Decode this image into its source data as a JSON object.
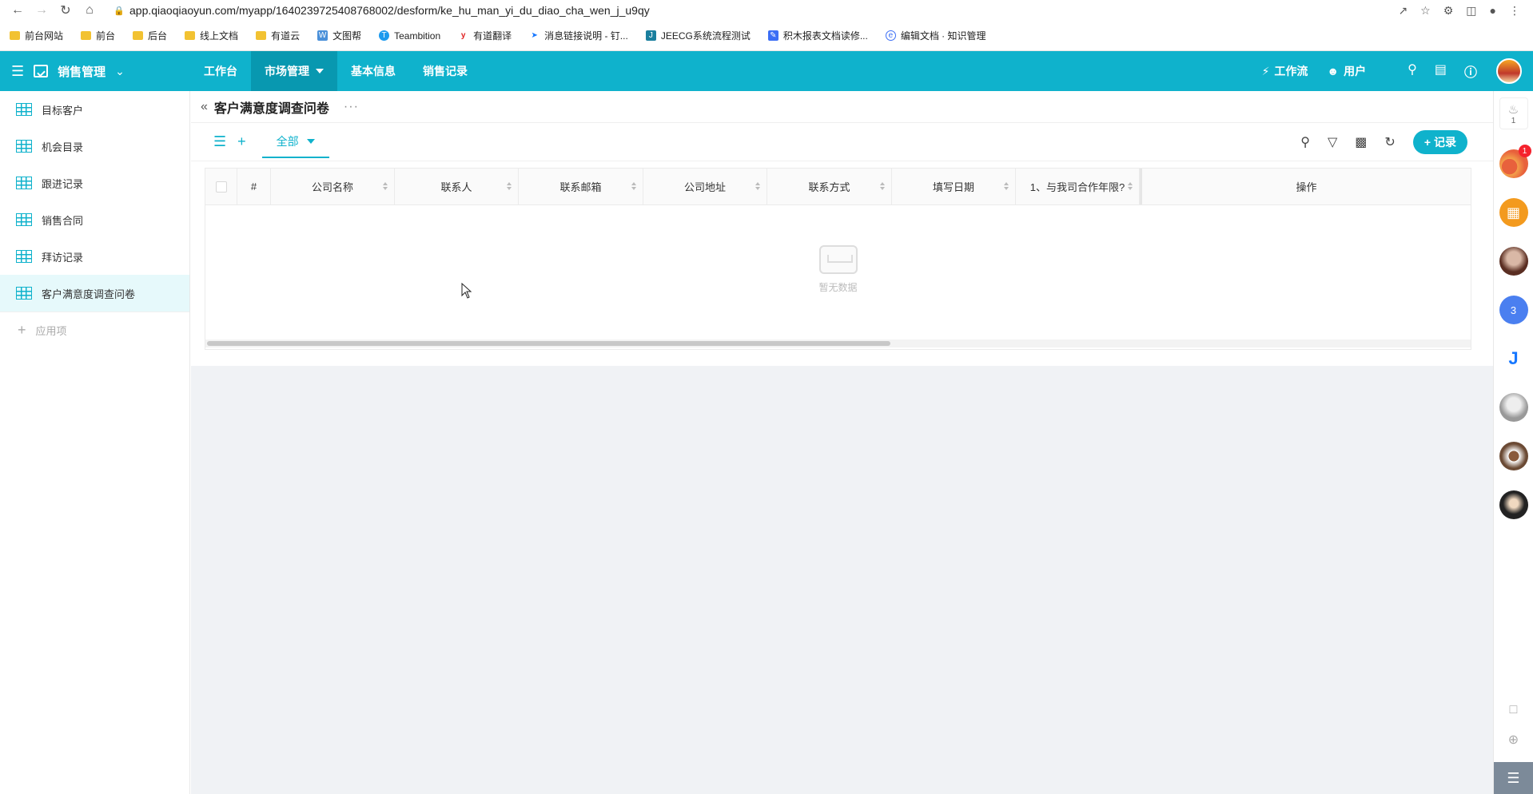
{
  "browser": {
    "url": "app.qiaoqiaoyun.com/myapp/1640239725408768002/desform/ke_hu_man_yi_du_diao_cha_wen_j_u9qy",
    "bookmarks": [
      "前台网站",
      "前台",
      "后台",
      "线上文档",
      "有道云",
      "文图帮",
      "Teambition",
      "有道翻译",
      "消息链接说明 - 钉...",
      "JEECG系统流程测试",
      "积木报表文档读修...",
      "编辑文档 · 知识管理"
    ]
  },
  "header": {
    "app_name": "销售管理",
    "menu": [
      "工作台",
      "市场管理",
      "基本信息",
      "销售记录"
    ],
    "active_menu": "市场管理",
    "workflow": "工作流",
    "user": "用户"
  },
  "sidebar": {
    "items": [
      "目标客户",
      "机会目录",
      "跟进记录",
      "销售合同",
      "拜访记录",
      "客户满意度调查问卷"
    ],
    "active": "客户满意度调查问卷",
    "add_label": "应用项"
  },
  "page": {
    "title": "客户满意度调查问卷",
    "more": "···",
    "view_tab": "全部",
    "add_record": "记录"
  },
  "table": {
    "columns": [
      "#",
      "公司名称",
      "联系人",
      "联系邮箱",
      "公司地址",
      "联系方式",
      "填写日期",
      "1、与我司合作年限?",
      "操作"
    ],
    "empty_text": "暂无数据"
  },
  "rail": {
    "bell_count": "1",
    "badge_count": "1",
    "number_avatar": "3"
  },
  "colors": {
    "primary": "#0fb2cc",
    "header_active": "#0898b0"
  }
}
